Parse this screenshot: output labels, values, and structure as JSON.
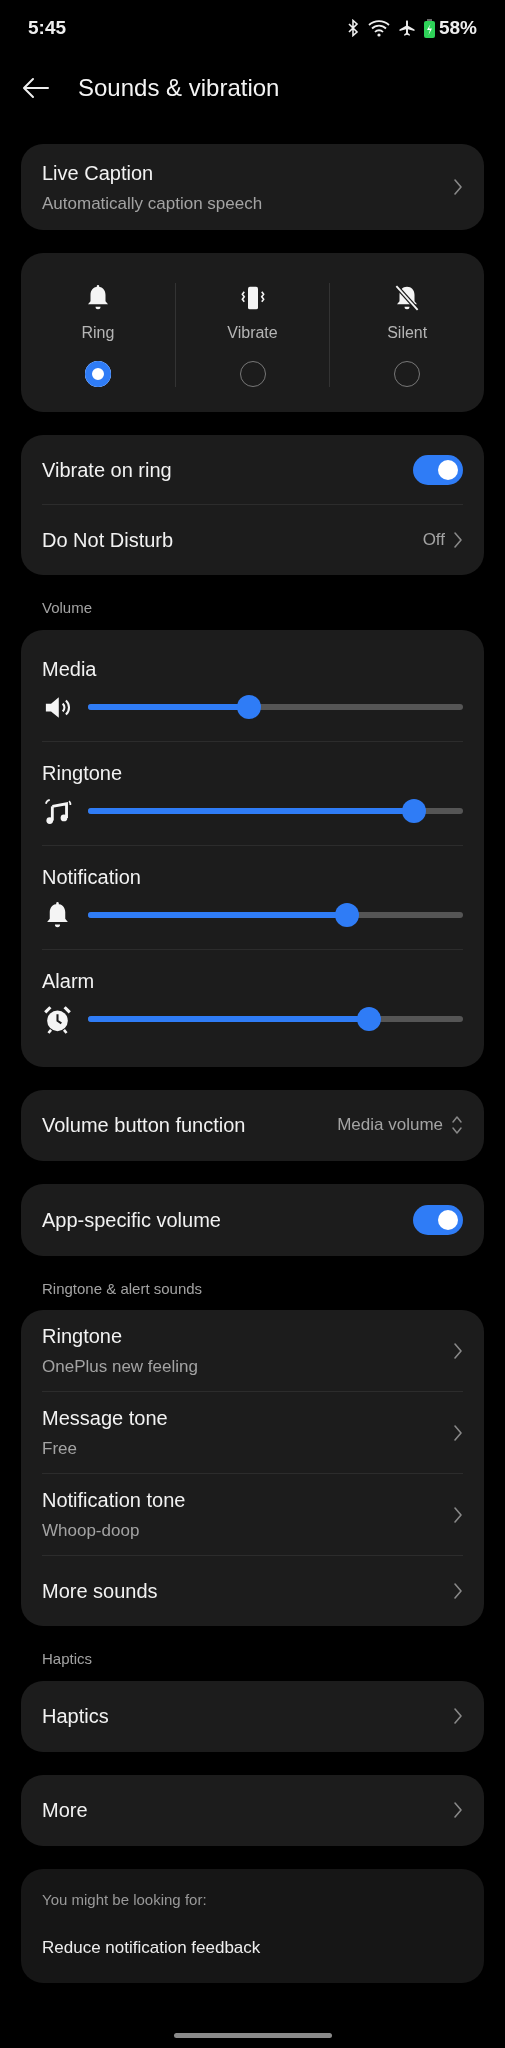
{
  "status_bar": {
    "time": "5:45",
    "battery": "58%"
  },
  "header": {
    "title": "Sounds & vibration"
  },
  "live_caption": {
    "title": "Live Caption",
    "subtitle": "Automatically caption speech"
  },
  "modes": [
    {
      "label": "Ring",
      "kind": "bell",
      "selected": true
    },
    {
      "label": "Vibrate",
      "kind": "vibrate",
      "selected": false
    },
    {
      "label": "Silent",
      "kind": "silent",
      "selected": false
    }
  ],
  "ring_settings": [
    {
      "kind": "toggle",
      "label": "Vibrate on ring",
      "on": true
    },
    {
      "kind": "link",
      "label": "Do Not Disturb",
      "value": "Off"
    }
  ],
  "volume": {
    "heading": "Volume",
    "sliders": [
      {
        "label": "Media",
        "kind": "speaker",
        "level": 0.43
      },
      {
        "label": "Ringtone",
        "kind": "music",
        "level": 0.87
      },
      {
        "label": "Notification",
        "kind": "bell",
        "level": 0.69
      },
      {
        "label": "Alarm",
        "kind": "alarm",
        "level": 0.75
      }
    ]
  },
  "volume_button": {
    "label": "Volume button function",
    "value": "Media volume"
  },
  "app_volume": {
    "label": "App-specific volume",
    "on": true
  },
  "sounds": {
    "heading": "Ringtone & alert sounds",
    "items": [
      {
        "title": "Ringtone",
        "subtitle": "OnePlus new feeling"
      },
      {
        "title": "Message tone",
        "subtitle": "Free"
      },
      {
        "title": "Notification tone",
        "subtitle": "Whoop-doop"
      },
      {
        "title": "More sounds"
      }
    ]
  },
  "haptics": {
    "heading": "Haptics",
    "items": [
      {
        "title": "Haptics"
      }
    ]
  },
  "more": {
    "title": "More"
  },
  "suggestions": {
    "heading": "You might be looking for:",
    "items": [
      "Reduce notification feedback"
    ]
  }
}
